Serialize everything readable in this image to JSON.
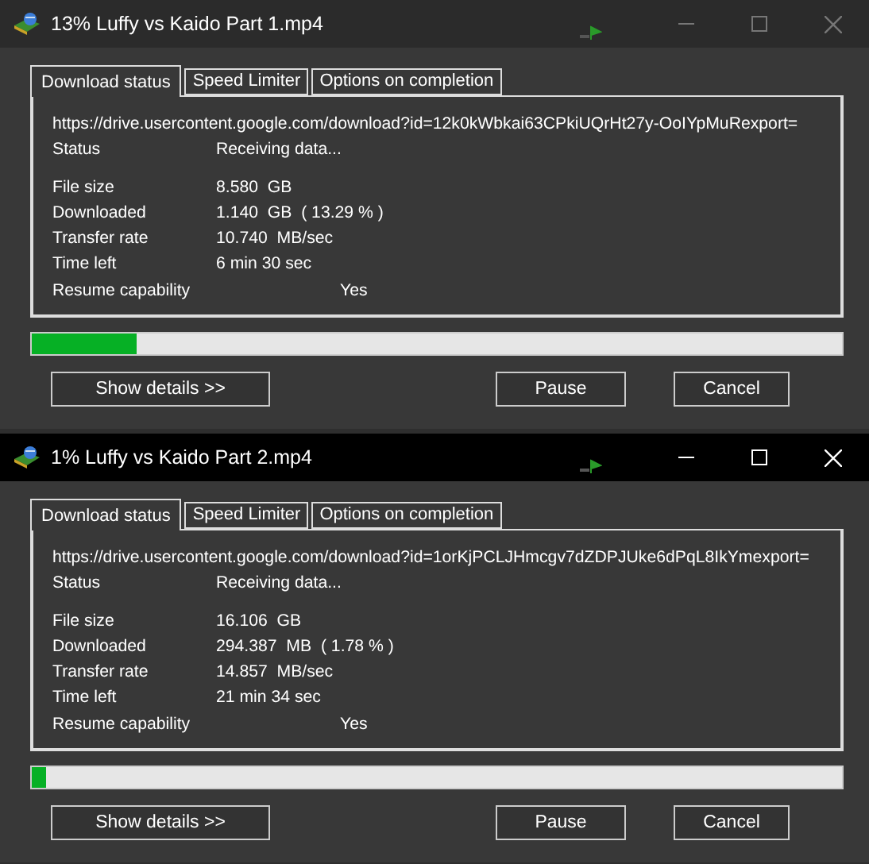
{
  "windows": [
    {
      "title": "13% Luffy vs Kaido Part 1.mp4",
      "active": false,
      "tabs": [
        {
          "label": "Download status",
          "selected": true
        },
        {
          "label": "Speed Limiter",
          "selected": false
        },
        {
          "label": "Options on completion",
          "selected": false
        }
      ],
      "url": "https://drive.usercontent.google.com/download?id=12k0kWbkai63CPkiUQrHt27y-OoIYpMuRexport=",
      "status": {
        "label": "Status",
        "value": "Receiving data..."
      },
      "fields": [
        {
          "label": "File size",
          "value": "8.580  GB"
        },
        {
          "label": "Downloaded",
          "value": "1.140  GB  ( 13.29 % )"
        },
        {
          "label": "Transfer rate",
          "value": "10.740  MB/sec"
        },
        {
          "label": "Time left",
          "value": "6 min 30 sec"
        }
      ],
      "resume": {
        "label": "Resume capability",
        "value": "Yes"
      },
      "level": 0.13,
      "buttons": {
        "details": "Show details >>",
        "pause": "Pause",
        "cancel": "Cancel"
      }
    },
    {
      "title": "1% Luffy vs Kaido Part 2.mp4",
      "active": true,
      "tabs": [
        {
          "label": "Download status",
          "selected": true
        },
        {
          "label": "Speed Limiter",
          "selected": false
        },
        {
          "label": "Options on completion",
          "selected": false
        }
      ],
      "url": "https://drive.usercontent.google.com/download?id=1orKjPCLJHmcgv7dZDPJUke6dPqL8IkYmexport=",
      "status": {
        "label": "Status",
        "value": "Receiving data..."
      },
      "fields": [
        {
          "label": "File size",
          "value": "16.106  GB"
        },
        {
          "label": "Downloaded",
          "value": "294.387  MB  ( 1.78 % )"
        },
        {
          "label": "Transfer rate",
          "value": "14.857  MB/sec"
        },
        {
          "label": "Time left",
          "value": "21 min 34 sec"
        }
      ],
      "resume": {
        "label": "Resume capability",
        "value": "Yes"
      },
      "level": 0.0178,
      "buttons": {
        "details": "Show details >>",
        "pause": "Pause",
        "cancel": "Cancel"
      }
    }
  ]
}
